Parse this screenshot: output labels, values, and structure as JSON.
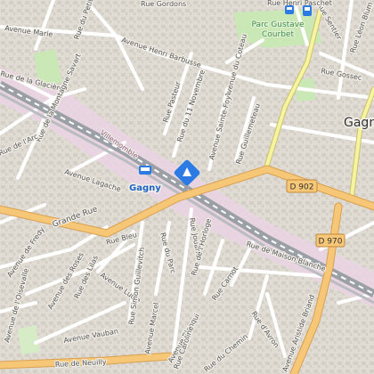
{
  "map": {
    "city_label": "Gagn",
    "station_label": "Gagny",
    "park_label_line1": "Parc Gustave",
    "park_label_line2": "Courbet",
    "railway_label": "Villemomble",
    "route_shields": [
      "D 902",
      "D 970"
    ],
    "streets": [
      "Avenue Marie",
      "Rue du Petit Reinc",
      "Avenue Henri Barbusse",
      "Avenue du Coteau",
      "Rue de la Glacière",
      "Rue de la Montagne Savart",
      "Rue Pasteur",
      "Rue du 11 Novembre",
      "Avenue Sainte-Foy",
      "Rue Guillemeteau",
      "Rue Gossec",
      "Rue Léon Blum",
      "Rue de l'Arc",
      "Avenue Lagache",
      "Grande Rue",
      "Avenue de Fredy",
      "Rue Bleu",
      "Rue Jouanet",
      "Rue du Parc",
      "Rue de l'Horloge",
      "Rue de Maison Blanche",
      "Avenue des Roses",
      "Rue des Lilas",
      "Avenue Lucie",
      "Rue Simon Guillevitch",
      "Avenue de l'Oisevalle",
      "Avenue Vauban",
      "Avenue Marcel",
      "Avenue Blanqui",
      "Rue Carnot",
      "Rue d'Avron",
      "Avenue Aristide Briand",
      "Rue de Neuilly",
      "Rue Sentier",
      "Rue Caroline",
      "Rue du Chemin",
      "Rue Henri Paschet",
      "Rue Gordons"
    ]
  },
  "colors": {
    "background": "#e0dcd3",
    "road": "#ffffff",
    "primary_road": "#f6c777",
    "primary_casing": "#d9a051",
    "secondary_road": "#f6f4a0",
    "railway": "#9aa0a6",
    "station_area": "#ead3e3",
    "park": "#c9e8b6",
    "transit_marker": "#2c7be5"
  },
  "icons": [
    "train-station-icon",
    "metro-icon",
    "bus-icon"
  ]
}
